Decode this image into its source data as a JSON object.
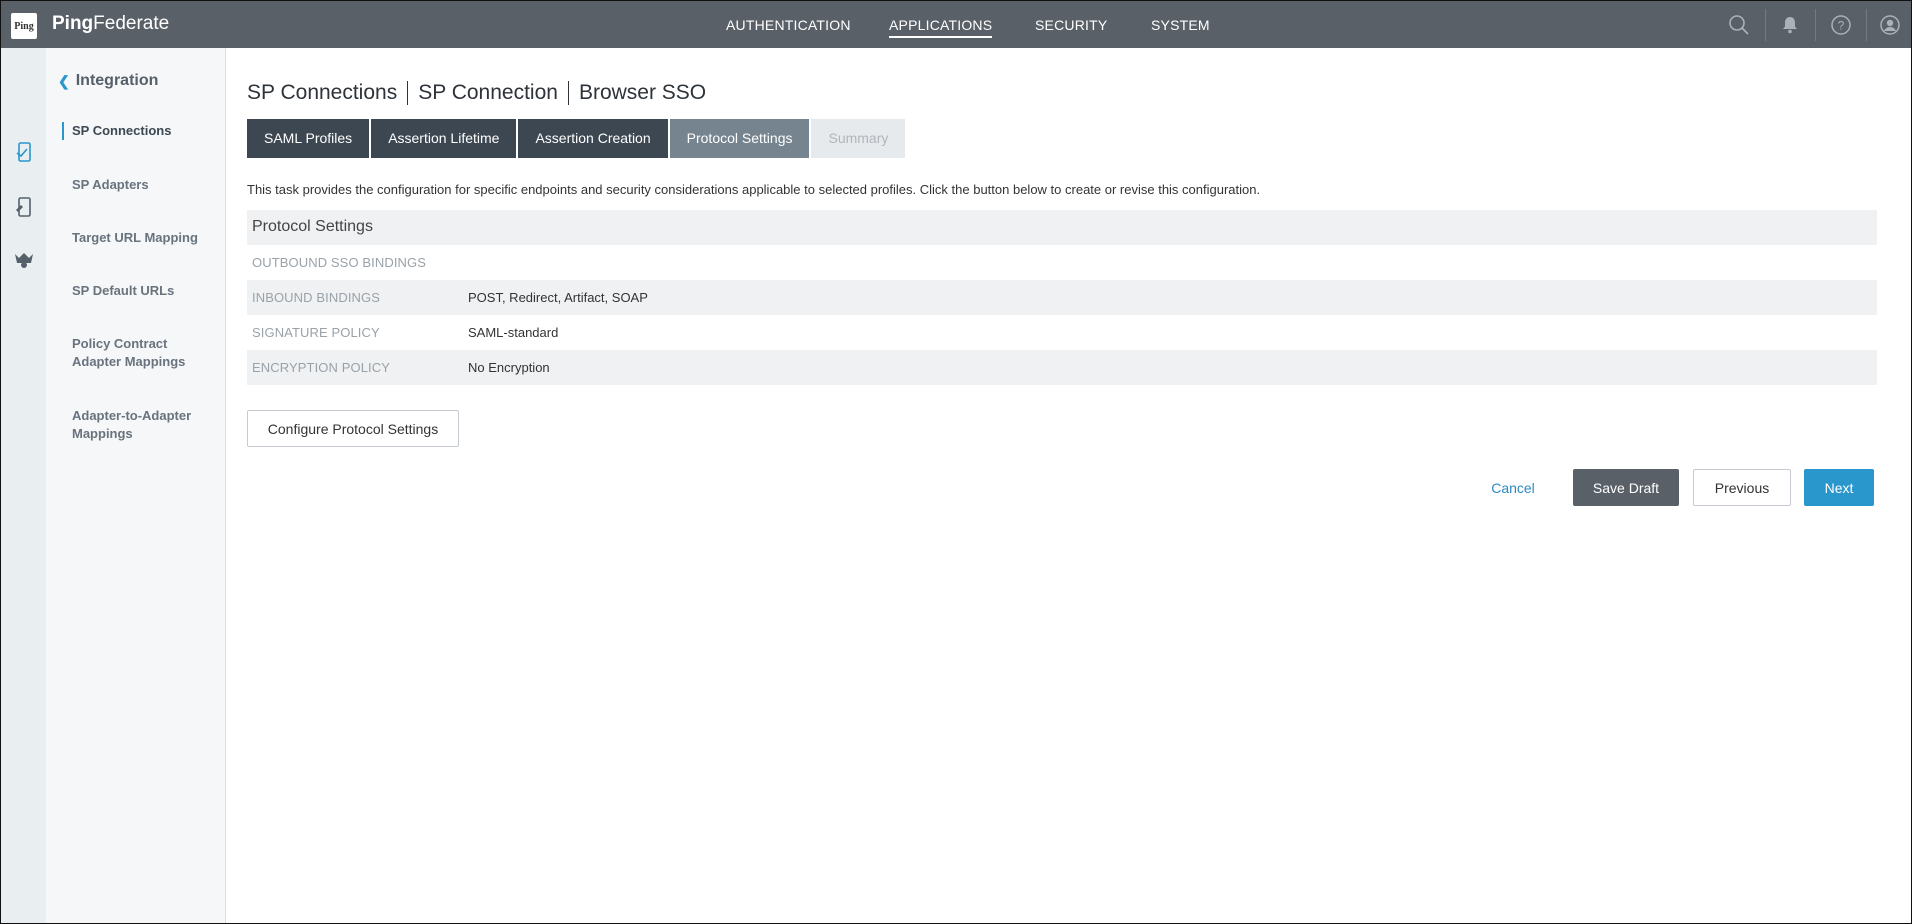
{
  "app": {
    "logo_text": "Ping",
    "brand_bold": "Ping",
    "brand_light": "Federate"
  },
  "topnav": {
    "items": [
      {
        "label": "AUTHENTICATION"
      },
      {
        "label": "APPLICATIONS",
        "active": true
      },
      {
        "label": "SECURITY"
      },
      {
        "label": "SYSTEM"
      }
    ],
    "icons": [
      "search-icon",
      "bell-icon",
      "help-icon",
      "user-icon"
    ]
  },
  "rail": {
    "icons": [
      "sp-connections-icon",
      "sp-adapters-icon",
      "target-mapping-icon"
    ]
  },
  "subnav": {
    "back_label": "Integration",
    "items": [
      {
        "label": "SP Connections",
        "active": true
      },
      {
        "label": "SP Adapters"
      },
      {
        "label": "Target URL Mapping"
      },
      {
        "label": "SP Default URLs"
      },
      {
        "label": "Policy Contract Adapter Mappings"
      },
      {
        "label": "Adapter-to-Adapter Mappings"
      }
    ]
  },
  "breadcrumb": [
    "SP Connections",
    "SP Connection",
    "Browser SSO"
  ],
  "tabs": [
    {
      "label": "SAML Profiles",
      "state": "done"
    },
    {
      "label": "Assertion Lifetime",
      "state": "done"
    },
    {
      "label": "Assertion Creation",
      "state": "done"
    },
    {
      "label": "Protocol Settings",
      "state": "current"
    },
    {
      "label": "Summary",
      "state": "disabled"
    }
  ],
  "description": "This task provides the configuration for specific endpoints and security considerations applicable to selected profiles. Click the button below to create or revise this configuration.",
  "panel": {
    "title": "Protocol Settings",
    "rows": [
      {
        "key": "OUTBOUND SSO BINDINGS",
        "value": ""
      },
      {
        "key": "INBOUND BINDINGS",
        "value": "POST, Redirect, Artifact, SOAP"
      },
      {
        "key": "SIGNATURE POLICY",
        "value": "SAML-standard"
      },
      {
        "key": "ENCRYPTION POLICY",
        "value": "No Encryption"
      }
    ]
  },
  "buttons": {
    "configure": "Configure Protocol Settings",
    "cancel": "Cancel",
    "save_draft": "Save Draft",
    "previous": "Previous",
    "next": "Next"
  },
  "colors": {
    "topbar": "#596068",
    "accent": "#2996cc",
    "tab_dark": "#3d4752",
    "tab_current": "#75848f"
  }
}
